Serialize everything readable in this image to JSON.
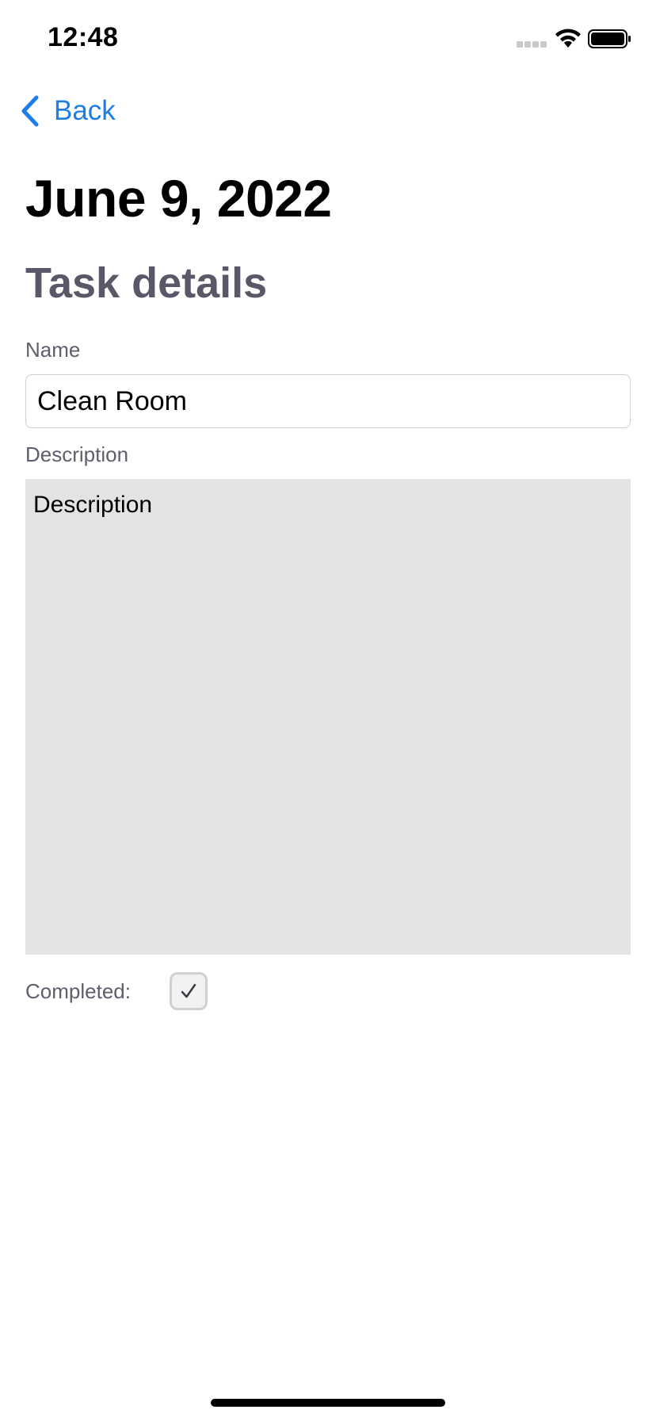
{
  "status_bar": {
    "time": "12:48",
    "icons": [
      "signal-icon",
      "wifi-icon",
      "battery-icon"
    ]
  },
  "nav": {
    "back_label": "Back",
    "back_icon": "chevron-left-icon"
  },
  "page": {
    "date_title": "June 9, 2022",
    "section_title": "Task details"
  },
  "form": {
    "name_label": "Name",
    "name_value": "Clean Room",
    "description_label": "Description",
    "description_value": "Description",
    "completed_label": "Completed:",
    "completed_checked": true
  },
  "colors": {
    "accent": "#1e7ee6",
    "section_title": "#585868",
    "label": "#5e5e6e",
    "description_bg": "#e3e3e5"
  }
}
